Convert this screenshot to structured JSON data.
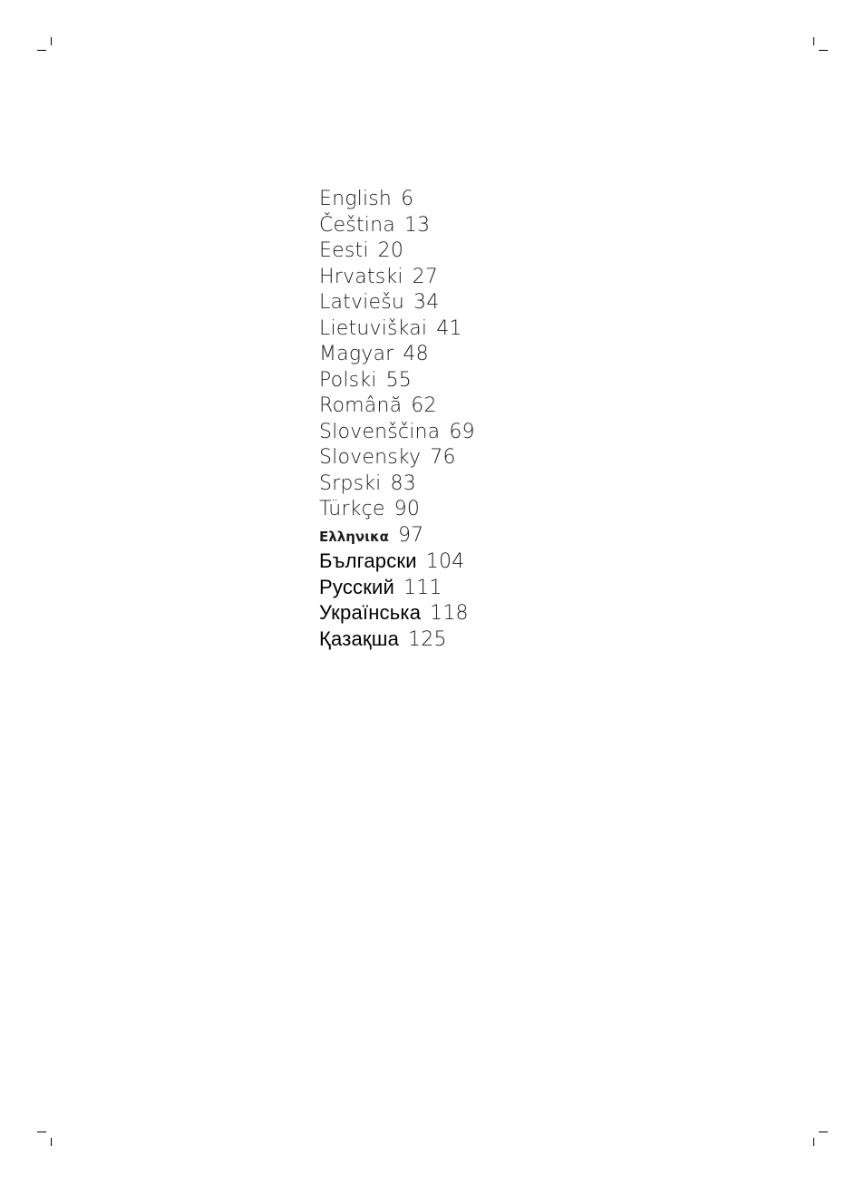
{
  "toc": {
    "entries": [
      {
        "language": "English",
        "page": "6"
      },
      {
        "language": "Čeština",
        "page": "13"
      },
      {
        "language": "Eesti",
        "page": "20"
      },
      {
        "language": "Hrvatski",
        "page": "27"
      },
      {
        "language": "Latviešu",
        "page": "34"
      },
      {
        "language": "Lietuviškai",
        "page": "41"
      },
      {
        "language": "Magyar",
        "page": "48"
      },
      {
        "language": "Polski",
        "page": "55"
      },
      {
        "language": "Română",
        "page": "62"
      },
      {
        "language": "Slovenščina",
        "page": "69"
      },
      {
        "language": "Slovensky",
        "page": "76"
      },
      {
        "language": "Srpski",
        "page": "83"
      },
      {
        "language": "Türkçe",
        "page": "90"
      },
      {
        "language": "Ελληνικα",
        "page": "97"
      },
      {
        "language": "Български",
        "page": "104"
      },
      {
        "language": "Русский",
        "page": "111"
      },
      {
        "language": "Українська",
        "page": "118"
      },
      {
        "language": "Қазақша",
        "page": "125"
      }
    ]
  }
}
